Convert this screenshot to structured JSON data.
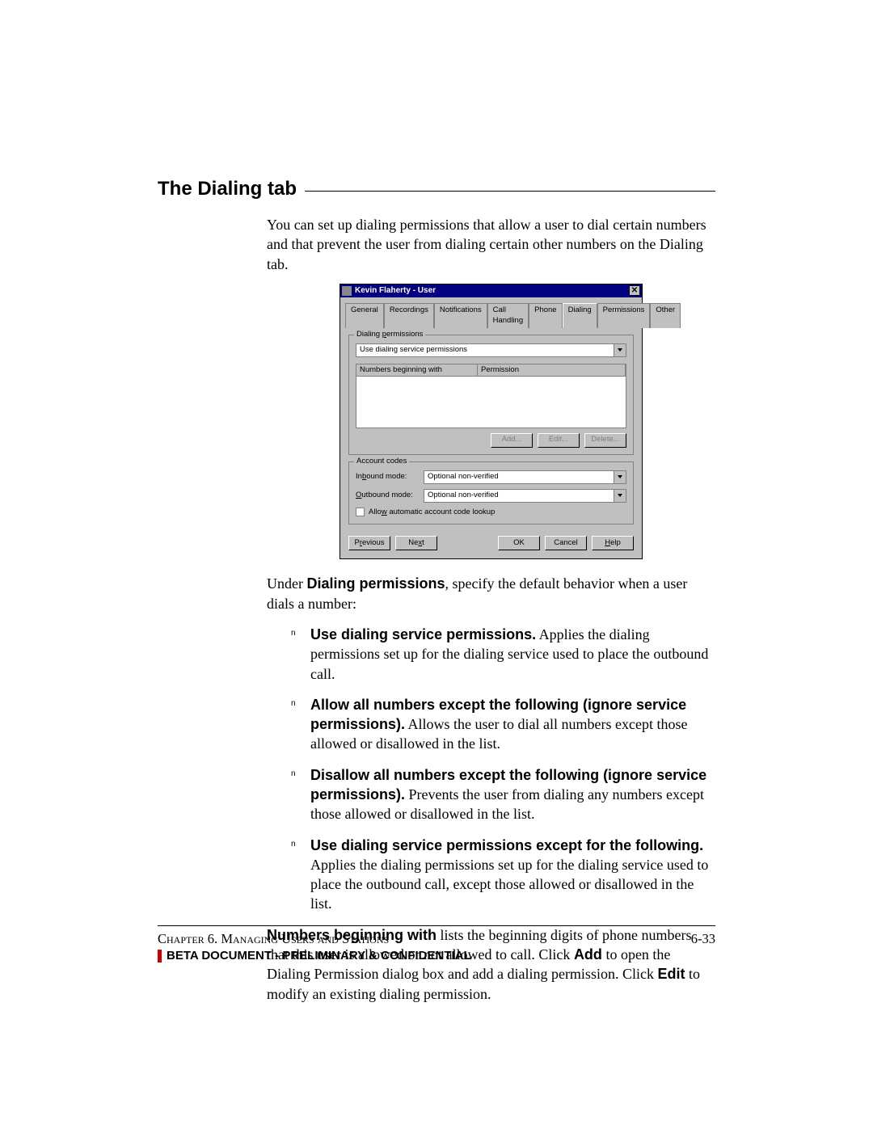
{
  "heading": "The Dialing tab",
  "intro": "You can set up dialing permissions that allow a user to dial certain numbers and that prevent the user from dialing certain other numbers on the Dialing tab.",
  "dialog": {
    "title": "Kevin Flaherty - User",
    "tabs": [
      "General",
      "Recordings",
      "Notifications",
      "Call Handling",
      "Phone",
      "Dialing",
      "Permissions",
      "Other"
    ],
    "active_tab_index": 5,
    "dialing_permissions": {
      "group_label": "Dialing permissions",
      "combo_value": "Use dialing service permissions",
      "col1": "Numbers beginning with",
      "col2": "Permission",
      "add": "Add...",
      "edit": "Edit...",
      "delete": "Delete..."
    },
    "account_codes": {
      "group_label": "Account codes",
      "inbound_label": "Inbound mode:",
      "inbound_value": "Optional non-verified",
      "outbound_label": "Outbound mode:",
      "outbound_value": "Optional non-verified",
      "checkbox_label": "Allow automatic account code lookup"
    },
    "buttons": {
      "previous": "Previous",
      "next": "Next",
      "ok": "OK",
      "cancel": "Cancel",
      "help": "Help"
    }
  },
  "para_under": {
    "prefix": "Under ",
    "bold": "Dialing permissions",
    "suffix": ", specify the default behavior when a user dials a number:"
  },
  "bullets": [
    {
      "bold": "Use dialing service permissions.",
      "rest": " Applies the dialing permissions set up for the dialing service used to place the outbound call."
    },
    {
      "bold": "Allow all numbers except the following (ignore service permissions).",
      "rest": " Allows the user to dial all numbers except those allowed or disallowed in the list."
    },
    {
      "bold": "Disallow all numbers except the following (ignore service permissions).",
      "rest": " Prevents the user from dialing any numbers except those allowed or disallowed in the list."
    },
    {
      "bold": "Use dialing service permissions except for the following.",
      "rest": " Applies the dialing permissions set up for the dialing service used to place the outbound call, except those allowed or disallowed in the list."
    }
  ],
  "para_numbers": {
    "b1": "Numbers beginning with",
    "t1": " lists the beginning digits of phone numbers that this user is allowed or not allowed to call. Click ",
    "b2": "Add",
    "t2": " to open the Dialing Permission dialog box and add a dialing permission. Click ",
    "b3": "Edit",
    "t3": " to modify an existing dialing permission."
  },
  "footer": {
    "chapter_prefix": "Chapter 6. ",
    "chapter_title": "Managing Users and Stations",
    "page": "6-33",
    "confidential": "BETA DOCUMENT - PRELIMINARY & CONFIDENTIAL"
  }
}
